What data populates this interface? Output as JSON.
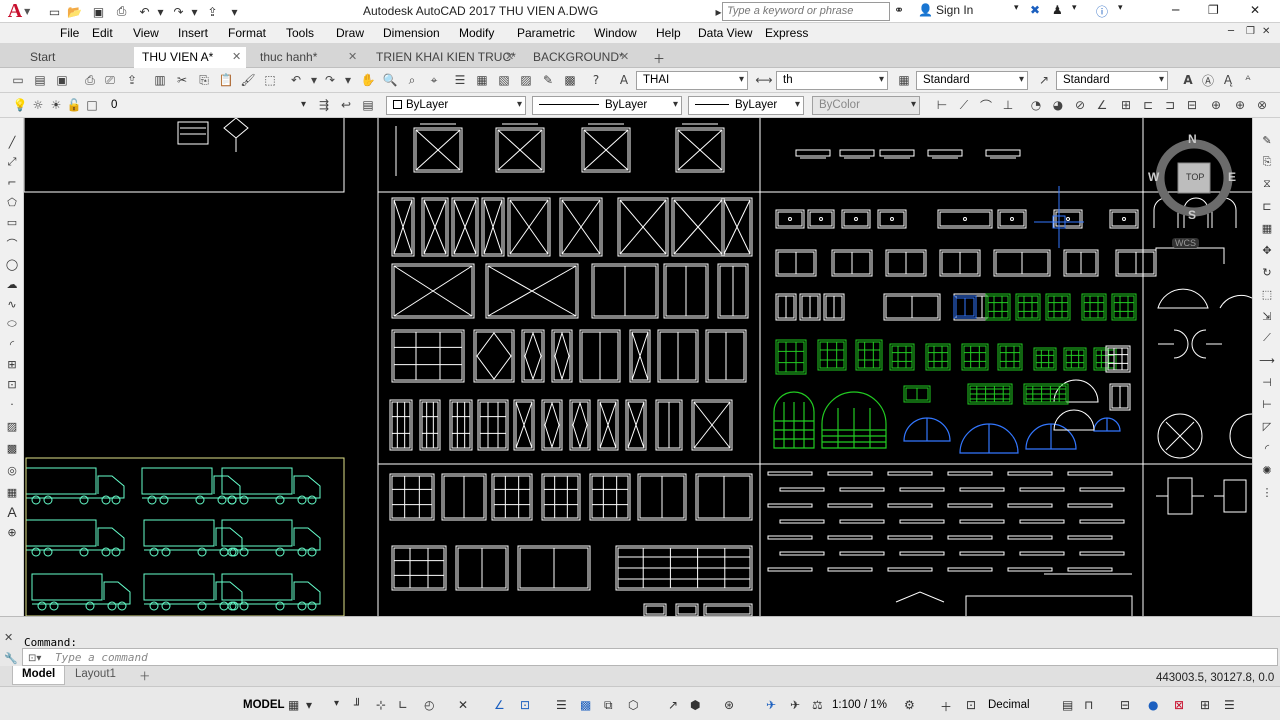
{
  "app": {
    "title": "Autodesk AutoCAD 2017    THU VIEN A.DWG",
    "logo": "A",
    "search_placeholder": "Type a keyword or phrase",
    "sign_in": "Sign In",
    "window_controls": [
      "minimize-icon",
      "restore-icon",
      "close-icon"
    ]
  },
  "menu": [
    "File",
    "Edit",
    "View",
    "Insert",
    "Format",
    "Tools",
    "Draw",
    "Dimension",
    "Modify",
    "Parametric",
    "Window",
    "Help",
    "Data View",
    "Express"
  ],
  "file_tabs": [
    {
      "label": "Start",
      "active": false,
      "closable": false
    },
    {
      "label": "THU VIEN A*",
      "active": true,
      "closable": true
    },
    {
      "label": "thuc hanh*",
      "active": false,
      "closable": true
    },
    {
      "label": "TRIEN KHAI KIEN TRUC*",
      "active": false,
      "closable": true
    },
    {
      "label": "BACKGROUND*",
      "active": false,
      "closable": true
    }
  ],
  "toolbar_styles": {
    "text_style": "THAI",
    "dim_style": "th",
    "table_style": "Standard",
    "multileader_style": "Standard"
  },
  "toolbar_layers": {
    "current_layer": "0",
    "color": "ByLayer",
    "linetype": "ByLayer",
    "lineweight": "ByLayer",
    "plot_style": "ByColor"
  },
  "viewcube": {
    "top": "TOP",
    "north": "N",
    "south": "S",
    "east": "E",
    "west": "W",
    "wcs": "WCS"
  },
  "command": {
    "history": "Command:",
    "placeholder": "Type a command"
  },
  "layout_tabs": [
    {
      "label": "Model",
      "active": true
    },
    {
      "label": "Layout1",
      "active": false
    }
  ],
  "coordinates": "443003.5, 30127.8, 0.0",
  "status": {
    "space": "MODEL",
    "annotation_scale": "1:100 / 1%",
    "units": "Decimal"
  },
  "colors": {
    "drawing_bg": "#000000",
    "lines_white": "#ffffff",
    "lines_green": "#22cc22",
    "lines_cyan": "#66ffcc",
    "lines_blue": "#3377ff",
    "brand_red": "#c8102e"
  }
}
